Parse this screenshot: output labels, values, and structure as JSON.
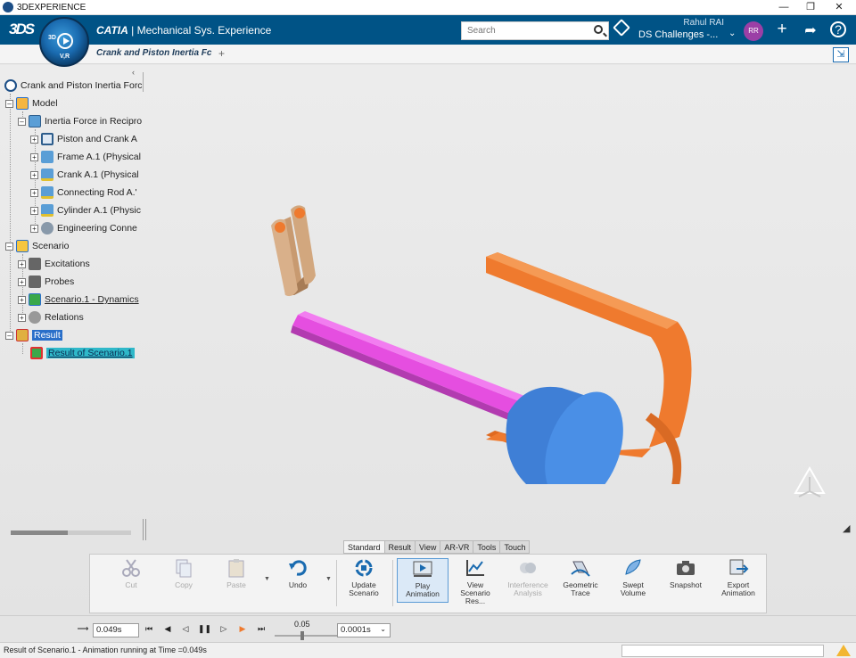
{
  "window": {
    "title": "3DEXPERIENCE"
  },
  "header": {
    "brand": "CATIA",
    "app_name": "Mechanical Sys. Experience",
    "search_placeholder": "Search",
    "user_name": "Rahul RAI",
    "tenant": "DS Challenges -...",
    "avatar_initials": "RR",
    "compass": {
      "top": "3D",
      "bottom": "V,R"
    }
  },
  "doc_tab": {
    "title": "Crank and Piston Inertia Fc"
  },
  "tree": {
    "root": "Crank and Piston Inertia Forc",
    "model": "Model",
    "product": "Inertia Force in Recipro",
    "parts": [
      "Piston and Crank A",
      "Frame A.1 (Physical",
      "Crank A.1 (Physical",
      "Connecting Rod A.'",
      "Cylinder A.1 (Physic",
      "Engineering Conne"
    ],
    "scenario": "Scenario",
    "scenario_items": [
      "Excitations",
      "Probes",
      "Scenario.1 - Dynamics",
      "Relations"
    ],
    "result": "Result",
    "result_item": "Result of Scenario.1"
  },
  "ribbon": {
    "tabs": [
      "Standard",
      "Result",
      "View",
      "AR-VR",
      "Tools",
      "Touch"
    ],
    "active_tab": "Standard",
    "commands": {
      "cut": "Cut",
      "copy": "Copy",
      "paste": "Paste",
      "undo": "Undo",
      "update_1": "Update",
      "update_2": "Scenario",
      "play_1": "Play",
      "play_2": "Animation",
      "view_1": "View",
      "view_2": "Scenario Res...",
      "interf_1": "Interference",
      "interf_2": "Analysis",
      "geo_1": "Geometric",
      "geo_2": "Trace",
      "swept_1": "Swept",
      "swept_2": "Volume",
      "snapshot": "Snapshot",
      "export_1": "Export",
      "export_2": "Animation"
    }
  },
  "player": {
    "time": "0.049s",
    "speed": "0.05",
    "step": "0.0001s"
  },
  "status": {
    "message": "Result of Scenario.1 - Animation running at Time =0.049s"
  },
  "colors": {
    "header_bg": "#005386",
    "rod": "#e54ee0",
    "piston": "#3f7fd6",
    "cylinder": "#ef7a2e",
    "crank": "#d2a77e"
  }
}
